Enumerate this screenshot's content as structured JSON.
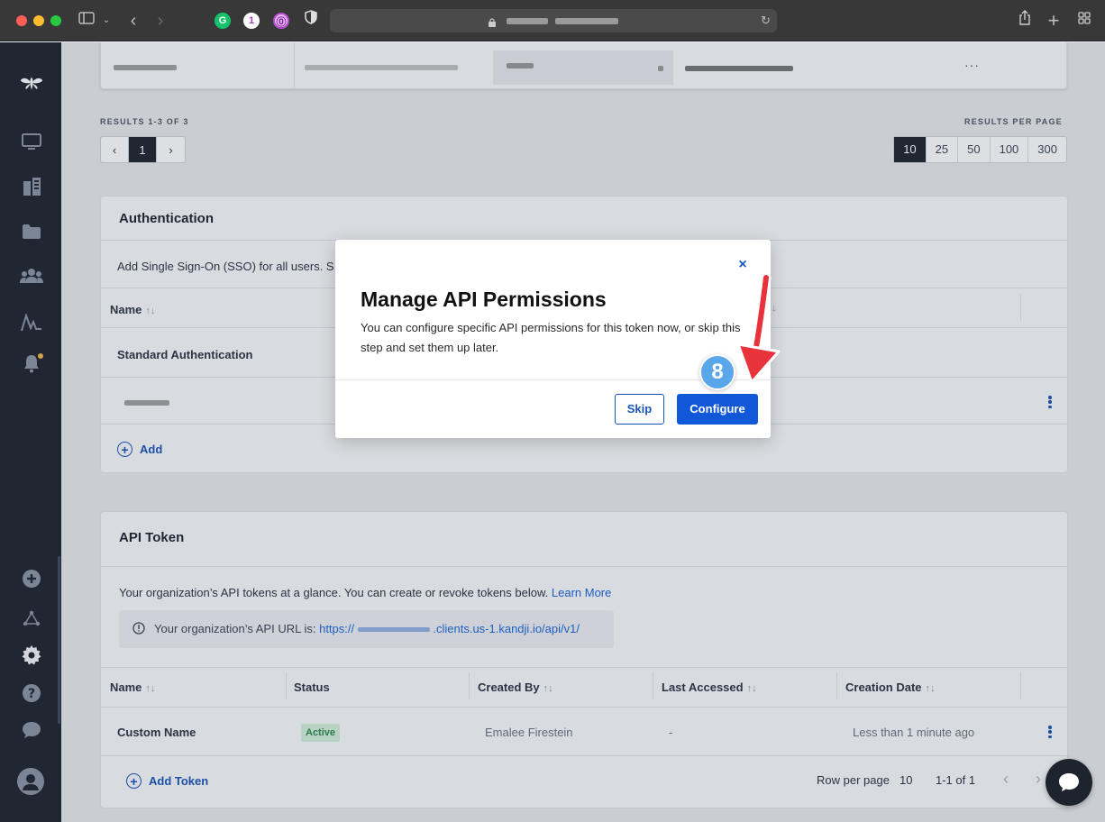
{
  "browser": {
    "extensions": [
      "grammarly",
      "1",
      "onepassword",
      "shield"
    ]
  },
  "results": {
    "count_label": "RESULTS 1-3 OF 3",
    "per_page_label": "RESULTS PER PAGE",
    "current_page": "1",
    "per_page_options": [
      "10",
      "25",
      "50",
      "100",
      "300"
    ],
    "per_page_selected": "10"
  },
  "authentication": {
    "title": "Authentication",
    "description": "Add Single Sign-On (SSO) for all users. S",
    "col_name": "Name",
    "row_label": "Standard Authentication",
    "add_label": "Add"
  },
  "api_token": {
    "title": "API Token",
    "description": "Your organization’s API tokens at a glance. You can create or revoke tokens below.",
    "learn_more": "Learn More",
    "url_label": "Your organization’s API URL is:",
    "url_prefix": "https://",
    "url_suffix": ".clients.us-1.kandji.io/api/v1/",
    "columns": [
      "Name",
      "Status",
      "Created By",
      "Last Accessed",
      "Creation Date"
    ],
    "row": {
      "name": "Custom Name",
      "status": "Active",
      "created_by": "Emalee Firestein",
      "last_accessed": "-",
      "creation_date": "Less than 1 minute ago"
    },
    "add_token": "Add Token",
    "rows_per_page_label": "Row per page",
    "rows_per_page_value": "10",
    "range": "1-1 of 1"
  },
  "modal": {
    "title": "Manage API Permissions",
    "body": "You can configure specific API permissions for this token now, or skip this step and set them up later.",
    "close": "×",
    "skip": "Skip",
    "configure": "Configure"
  },
  "annotation": {
    "step": "8",
    "color": "#e8323c"
  },
  "colors": {
    "primary": "#1058d8",
    "sidebar": "#1e242e",
    "active_badge": "#d3f0da"
  }
}
